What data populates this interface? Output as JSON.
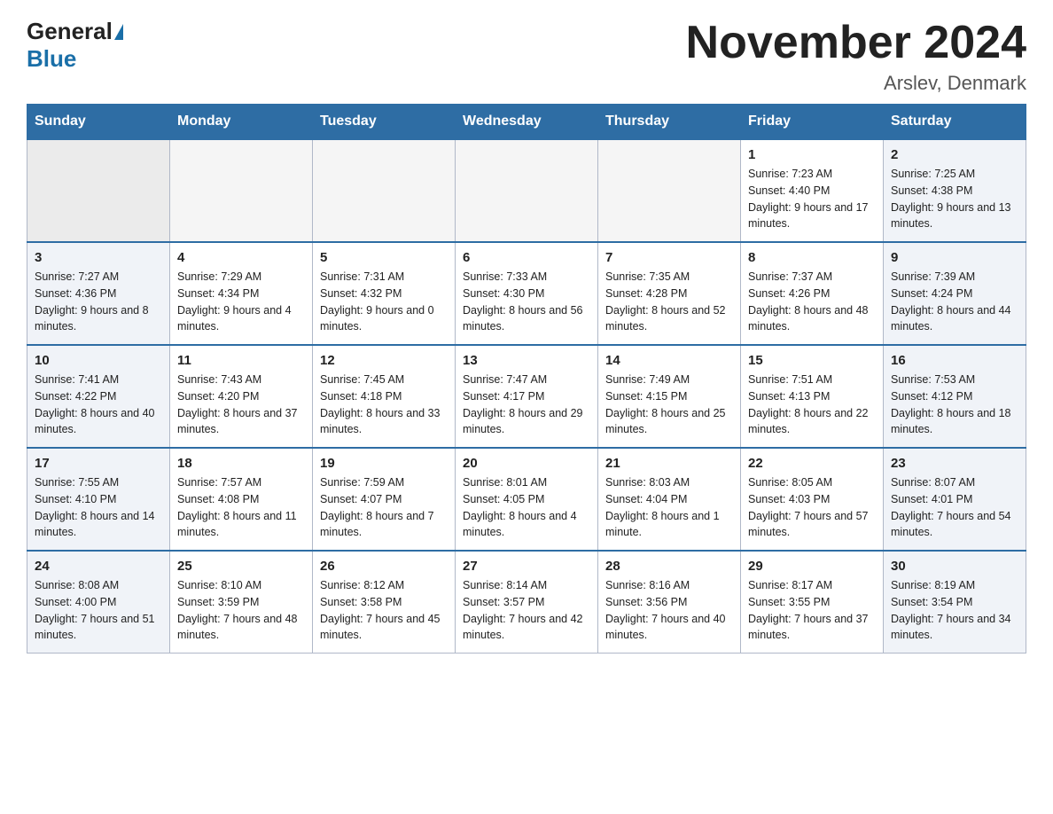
{
  "header": {
    "logo_general": "General",
    "logo_blue": "Blue",
    "month_title": "November 2024",
    "location": "Arslev, Denmark"
  },
  "days_of_week": [
    "Sunday",
    "Monday",
    "Tuesday",
    "Wednesday",
    "Thursday",
    "Friday",
    "Saturday"
  ],
  "weeks": [
    [
      {
        "day": "",
        "info": ""
      },
      {
        "day": "",
        "info": ""
      },
      {
        "day": "",
        "info": ""
      },
      {
        "day": "",
        "info": ""
      },
      {
        "day": "",
        "info": ""
      },
      {
        "day": "1",
        "info": "Sunrise: 7:23 AM\nSunset: 4:40 PM\nDaylight: 9 hours and 17 minutes."
      },
      {
        "day": "2",
        "info": "Sunrise: 7:25 AM\nSunset: 4:38 PM\nDaylight: 9 hours and 13 minutes."
      }
    ],
    [
      {
        "day": "3",
        "info": "Sunrise: 7:27 AM\nSunset: 4:36 PM\nDaylight: 9 hours and 8 minutes."
      },
      {
        "day": "4",
        "info": "Sunrise: 7:29 AM\nSunset: 4:34 PM\nDaylight: 9 hours and 4 minutes."
      },
      {
        "day": "5",
        "info": "Sunrise: 7:31 AM\nSunset: 4:32 PM\nDaylight: 9 hours and 0 minutes."
      },
      {
        "day": "6",
        "info": "Sunrise: 7:33 AM\nSunset: 4:30 PM\nDaylight: 8 hours and 56 minutes."
      },
      {
        "day": "7",
        "info": "Sunrise: 7:35 AM\nSunset: 4:28 PM\nDaylight: 8 hours and 52 minutes."
      },
      {
        "day": "8",
        "info": "Sunrise: 7:37 AM\nSunset: 4:26 PM\nDaylight: 8 hours and 48 minutes."
      },
      {
        "day": "9",
        "info": "Sunrise: 7:39 AM\nSunset: 4:24 PM\nDaylight: 8 hours and 44 minutes."
      }
    ],
    [
      {
        "day": "10",
        "info": "Sunrise: 7:41 AM\nSunset: 4:22 PM\nDaylight: 8 hours and 40 minutes."
      },
      {
        "day": "11",
        "info": "Sunrise: 7:43 AM\nSunset: 4:20 PM\nDaylight: 8 hours and 37 minutes."
      },
      {
        "day": "12",
        "info": "Sunrise: 7:45 AM\nSunset: 4:18 PM\nDaylight: 8 hours and 33 minutes."
      },
      {
        "day": "13",
        "info": "Sunrise: 7:47 AM\nSunset: 4:17 PM\nDaylight: 8 hours and 29 minutes."
      },
      {
        "day": "14",
        "info": "Sunrise: 7:49 AM\nSunset: 4:15 PM\nDaylight: 8 hours and 25 minutes."
      },
      {
        "day": "15",
        "info": "Sunrise: 7:51 AM\nSunset: 4:13 PM\nDaylight: 8 hours and 22 minutes."
      },
      {
        "day": "16",
        "info": "Sunrise: 7:53 AM\nSunset: 4:12 PM\nDaylight: 8 hours and 18 minutes."
      }
    ],
    [
      {
        "day": "17",
        "info": "Sunrise: 7:55 AM\nSunset: 4:10 PM\nDaylight: 8 hours and 14 minutes."
      },
      {
        "day": "18",
        "info": "Sunrise: 7:57 AM\nSunset: 4:08 PM\nDaylight: 8 hours and 11 minutes."
      },
      {
        "day": "19",
        "info": "Sunrise: 7:59 AM\nSunset: 4:07 PM\nDaylight: 8 hours and 7 minutes."
      },
      {
        "day": "20",
        "info": "Sunrise: 8:01 AM\nSunset: 4:05 PM\nDaylight: 8 hours and 4 minutes."
      },
      {
        "day": "21",
        "info": "Sunrise: 8:03 AM\nSunset: 4:04 PM\nDaylight: 8 hours and 1 minute."
      },
      {
        "day": "22",
        "info": "Sunrise: 8:05 AM\nSunset: 4:03 PM\nDaylight: 7 hours and 57 minutes."
      },
      {
        "day": "23",
        "info": "Sunrise: 8:07 AM\nSunset: 4:01 PM\nDaylight: 7 hours and 54 minutes."
      }
    ],
    [
      {
        "day": "24",
        "info": "Sunrise: 8:08 AM\nSunset: 4:00 PM\nDaylight: 7 hours and 51 minutes."
      },
      {
        "day": "25",
        "info": "Sunrise: 8:10 AM\nSunset: 3:59 PM\nDaylight: 7 hours and 48 minutes."
      },
      {
        "day": "26",
        "info": "Sunrise: 8:12 AM\nSunset: 3:58 PM\nDaylight: 7 hours and 45 minutes."
      },
      {
        "day": "27",
        "info": "Sunrise: 8:14 AM\nSunset: 3:57 PM\nDaylight: 7 hours and 42 minutes."
      },
      {
        "day": "28",
        "info": "Sunrise: 8:16 AM\nSunset: 3:56 PM\nDaylight: 7 hours and 40 minutes."
      },
      {
        "day": "29",
        "info": "Sunrise: 8:17 AM\nSunset: 3:55 PM\nDaylight: 7 hours and 37 minutes."
      },
      {
        "day": "30",
        "info": "Sunrise: 8:19 AM\nSunset: 3:54 PM\nDaylight: 7 hours and 34 minutes."
      }
    ]
  ]
}
